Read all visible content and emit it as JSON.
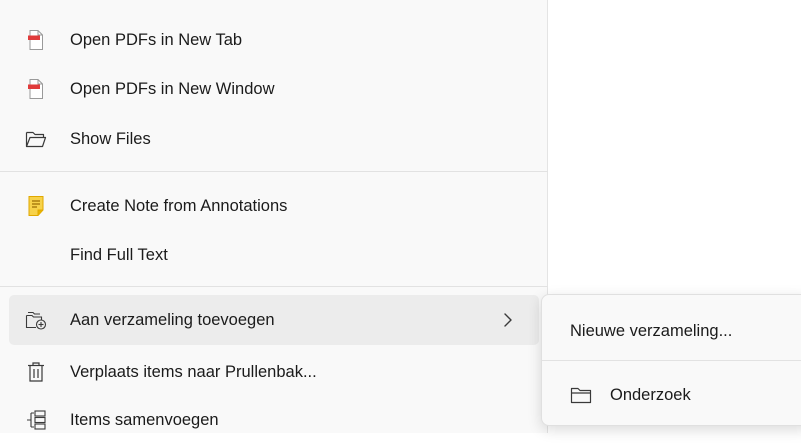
{
  "context_menu": {
    "items": [
      {
        "label": "Open PDFs in New Tab",
        "icon": "pdf-icon"
      },
      {
        "label": "Open PDFs in New Window",
        "icon": "pdf-icon"
      },
      {
        "label": "Show Files",
        "icon": "folder-open-icon"
      },
      {
        "label": "Create Note from Annotations",
        "icon": "note-icon"
      },
      {
        "label": "Find Full Text",
        "icon": ""
      },
      {
        "label": "Aan verzameling toevoegen",
        "icon": "collection-add-icon",
        "has_submenu": true
      },
      {
        "label": "Verplaats items naar Prullenbak...",
        "icon": "trash-icon"
      },
      {
        "label": "Items samenvoegen",
        "icon": "merge-icon"
      }
    ]
  },
  "submenu": {
    "items": [
      {
        "label": "Nieuwe verzameling..."
      },
      {
        "label": "Onderzoek",
        "icon": "folder-icon"
      }
    ]
  },
  "colors": {
    "pdf_red": "#e03b3b",
    "note_yellow": "#f2b705",
    "icon_gray": "#3a3a3a"
  }
}
